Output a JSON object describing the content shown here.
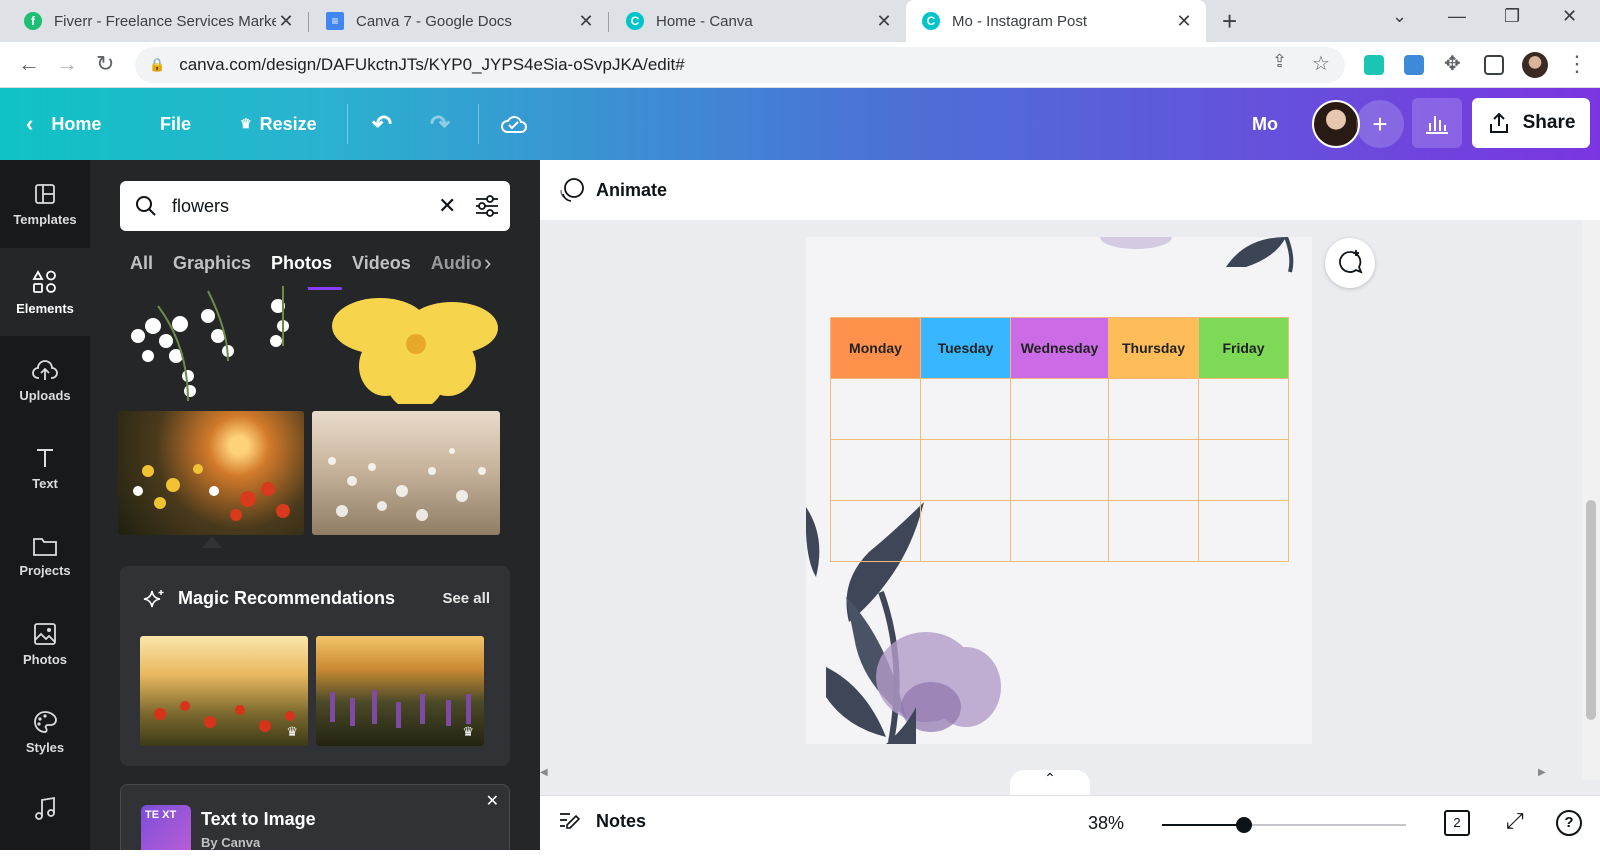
{
  "browser": {
    "tabs": [
      {
        "title": "Fiverr - Freelance Services Marketplace",
        "favicon": "fiverr-icon",
        "color": "#1dbf73"
      },
      {
        "title": "Canva 7 - Google Docs",
        "favicon": "docs-icon",
        "color": "#4285f4"
      },
      {
        "title": "Home - Canva",
        "favicon": "canva-icon",
        "color": "#00c4cc"
      },
      {
        "title": "Mo - Instagram Post",
        "favicon": "canva-icon",
        "color": "#00c4cc"
      }
    ],
    "url": "canva.com/design/DAFUkctnJTs/KYP0_JYPS4eSia-oSvpJKA/edit#"
  },
  "header": {
    "home": "Home",
    "file": "File",
    "resize": "Resize",
    "user_name": "Mo",
    "share": "Share"
  },
  "rail": {
    "items": [
      {
        "label": "Templates",
        "icon": "templates-icon"
      },
      {
        "label": "Elements",
        "icon": "elements-icon"
      },
      {
        "label": "Uploads",
        "icon": "uploads-icon"
      },
      {
        "label": "Text",
        "icon": "text-icon"
      },
      {
        "label": "Projects",
        "icon": "projects-icon"
      },
      {
        "label": "Photos",
        "icon": "photos-icon"
      },
      {
        "label": "Styles",
        "icon": "styles-icon"
      }
    ]
  },
  "panel": {
    "search_value": "flowers",
    "tabs": [
      "All",
      "Graphics",
      "Photos",
      "Videos",
      "Audio"
    ],
    "active_tab": "Photos",
    "magic_title": "Magic Recommendations",
    "see_all": "See all",
    "tti_title": "Text to Image",
    "tti_subtitle": "By Canva"
  },
  "editor": {
    "animate": "Animate",
    "calendar_headers": [
      {
        "day": "Monday",
        "color": "#ff914d"
      },
      {
        "day": "Tuesday",
        "color": "#38b6ff"
      },
      {
        "day": "Wednesday",
        "color": "#cb6ce6"
      },
      {
        "day": "Thursday",
        "color": "#ffbd59"
      },
      {
        "day": "Friday",
        "color": "#7ed957"
      }
    ],
    "notes": "Notes",
    "zoom": "38%",
    "page_count": "2"
  }
}
